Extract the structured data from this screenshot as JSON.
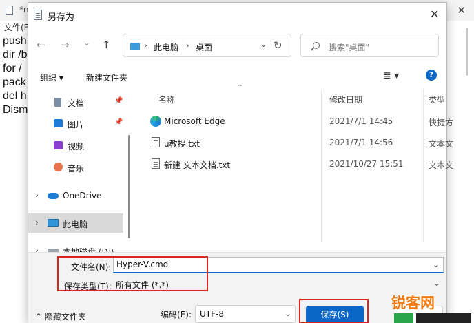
{
  "background": {
    "title": "*newdoc",
    "menu": "文件(F)",
    "lines": [
      "push",
      "dir /b",
      "for /",
      "pack",
      "del h",
      "Dism"
    ]
  },
  "dialog": {
    "title": "另存为",
    "close_glyph": "✕"
  },
  "nav": {
    "back": "←",
    "forward": "→",
    "recent": "⌄",
    "up": "↑",
    "address": [
      "此电脑",
      "桌面"
    ],
    "search_placeholder": "搜索\"桌面\""
  },
  "toolbar": {
    "organize": "组织 ▾",
    "new_folder": "新建文件夹",
    "view": "≣ ▾",
    "help": "?"
  },
  "sidebar": {
    "items": [
      {
        "label": "文档",
        "pinned": true
      },
      {
        "label": "图片",
        "pinned": true
      },
      {
        "label": "视频"
      },
      {
        "label": "音乐"
      },
      {
        "label": "OneDrive"
      },
      {
        "label": "此电脑",
        "selected": true
      },
      {
        "label": "本地磁盘 (D:)"
      }
    ]
  },
  "filelist": {
    "columns": [
      "名称",
      "修改日期",
      "类型"
    ],
    "rows": [
      {
        "name": "Microsoft Edge",
        "date": "2021/7/1 14:45",
        "type": "快捷方"
      },
      {
        "name": "u教授.txt",
        "date": "2021/7/1 14:56",
        "type": "文本文"
      },
      {
        "name": "新建 文本文档.txt",
        "date": "2021/10/27 15:51",
        "type": "文本文"
      }
    ]
  },
  "fields": {
    "filename_label": "文件名(N):",
    "filename_value": "Hyper-V.cmd",
    "filetype_label": "保存类型(T):",
    "filetype_value": "所有文件 (*.*)"
  },
  "footer": {
    "hide_folders": "隐藏文件夹",
    "encoding_label": "编码(E):",
    "encoding_value": "UTF-8",
    "save": "保存(S)"
  },
  "watermark": {
    "text": "锐客网"
  },
  "colors": {
    "accent": "#0a67c8",
    "highlight": "#d9261c",
    "watermark": "#f07a10"
  }
}
